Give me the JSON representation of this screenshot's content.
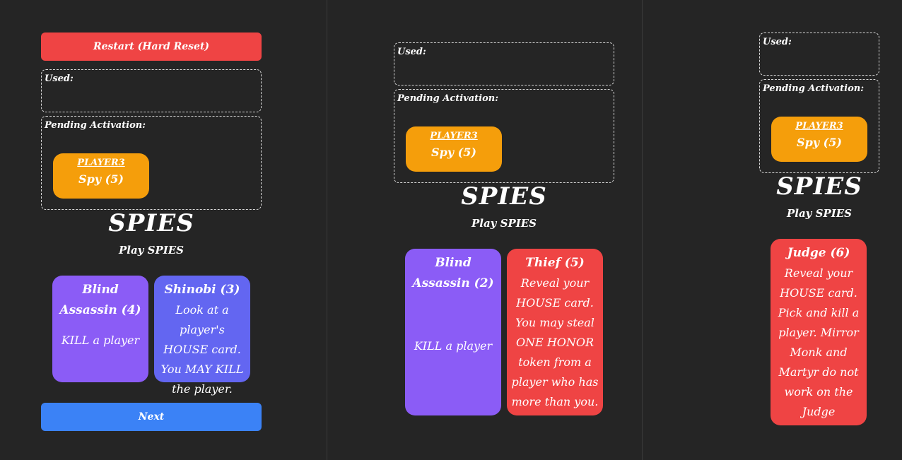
{
  "colors": {
    "background": "#252525",
    "restart": "#ef4444",
    "next": "#3b82f6",
    "pending": "#f59e0b",
    "purple": "#8b5cf6",
    "indigo": "#6366f1",
    "red": "#ef4444"
  },
  "restart_label": "Restart (Hard Reset)",
  "next_label": "Next",
  "used_label": "Used:",
  "pending_label": "Pending Activation:",
  "pending_card": {
    "player": "PLAYER3",
    "card": "Spy (5)"
  },
  "title": "SPIES",
  "subtitle": "Play SPIES",
  "panel1": {
    "cards": [
      {
        "name": "Blind Assassin (4)",
        "desc": "KILL a player",
        "color": "#8b5cf6"
      },
      {
        "name": "Shinobi (3)",
        "desc": "Look at a player's HOUSE card. You MAY KILL the player.",
        "color": "#6366f1"
      }
    ]
  },
  "panel2": {
    "cards": [
      {
        "name": "Blind Assassin (2)",
        "desc": "KILL a player",
        "color": "#8b5cf6"
      },
      {
        "name": "Thief (5)",
        "desc": "Reveal your HOUSE card. You may steal ONE HONOR token from a player who has more than you.",
        "color": "#ef4444"
      }
    ]
  },
  "panel3": {
    "cards": [
      {
        "name": "Judge (6)",
        "desc": "Reveal your HOUSE card. Pick and kill a player. Mirror Monk and Martyr do not work on the Judge",
        "color": "#ef4444"
      }
    ]
  }
}
